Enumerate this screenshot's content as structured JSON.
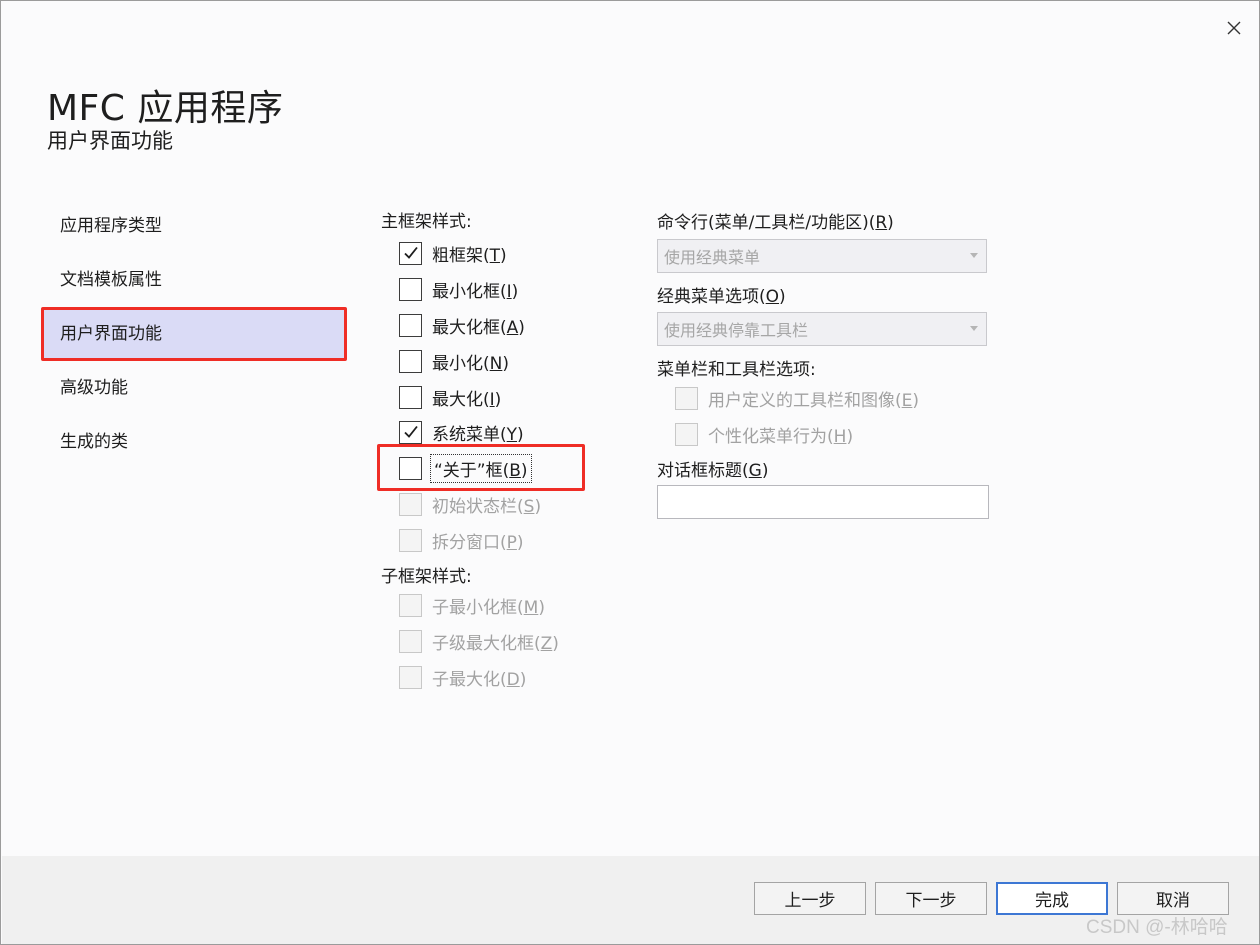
{
  "dialog": {
    "title": "MFC 应用程序",
    "subtitle": "用户界面功能"
  },
  "nav": {
    "items": [
      {
        "label": "应用程序类型",
        "selected": false
      },
      {
        "label": "文档模板属性",
        "selected": false
      },
      {
        "label": "用户界面功能",
        "selected": true
      },
      {
        "label": "高级功能",
        "selected": false
      },
      {
        "label": "生成的类",
        "selected": false
      }
    ]
  },
  "main_frame": {
    "label": "主框架样式:",
    "options": [
      {
        "text": "粗框架(",
        "key": "T",
        "tail": ")",
        "checked": true,
        "enabled": true
      },
      {
        "text": "最小化框(",
        "key": "I",
        "tail": ")",
        "checked": false,
        "enabled": true
      },
      {
        "text": "最大化框(",
        "key": "A",
        "tail": ")",
        "checked": false,
        "enabled": true
      },
      {
        "text": "最小化(",
        "key": "N",
        "tail": ")",
        "checked": false,
        "enabled": true
      },
      {
        "text": "最大化(",
        "key": "I",
        "tail": ")",
        "checked": false,
        "enabled": true
      },
      {
        "text": "系统菜单(",
        "key": "Y",
        "tail": ")",
        "checked": true,
        "enabled": true
      },
      {
        "text": "“关于”框(",
        "key": "B",
        "tail": ")",
        "checked": false,
        "enabled": true,
        "focused": true
      },
      {
        "text": "初始状态栏(",
        "key": "S",
        "tail": ")",
        "checked": false,
        "enabled": false
      },
      {
        "text": "拆分窗口(",
        "key": "P",
        "tail": ")",
        "checked": false,
        "enabled": false
      }
    ]
  },
  "child_frame": {
    "label": "子框架样式:",
    "options": [
      {
        "text": "子最小化框(",
        "key": "M",
        "tail": ")",
        "checked": false,
        "enabled": false
      },
      {
        "text": "子级最大化框(",
        "key": "Z",
        "tail": ")",
        "checked": false,
        "enabled": false
      },
      {
        "text": "子最大化(",
        "key": "D",
        "tail": ")",
        "checked": false,
        "enabled": false
      }
    ]
  },
  "command_bar": {
    "label_text": "命令行(菜单/工具栏/功能区)(",
    "label_key": "R",
    "label_tail": ")",
    "value": "使用经典菜单"
  },
  "classic_menu": {
    "label_text": "经典菜单选项(",
    "label_key": "O",
    "label_tail": ")",
    "value": "使用经典停靠工具栏"
  },
  "menubar_options": {
    "label": "菜单栏和工具栏选项:",
    "options": [
      {
        "text": "用户定义的工具栏和图像(",
        "key": "E",
        "tail": ")",
        "checked": false,
        "enabled": false
      },
      {
        "text": "个性化菜单行为(",
        "key": "H",
        "tail": ")",
        "checked": false,
        "enabled": false
      }
    ]
  },
  "dialog_title": {
    "label_text": "对话框标题(",
    "label_key": "G",
    "label_tail": ")",
    "value": ""
  },
  "buttons": {
    "prev": "上一步",
    "next": "下一步",
    "finish": "完成",
    "cancel": "取消"
  },
  "watermark": "CSDN @-林哈哈",
  "colors": {
    "highlight": "#ef2d26",
    "nav_selected": "#dadbf6",
    "default_button_border": "#3d77d4"
  }
}
